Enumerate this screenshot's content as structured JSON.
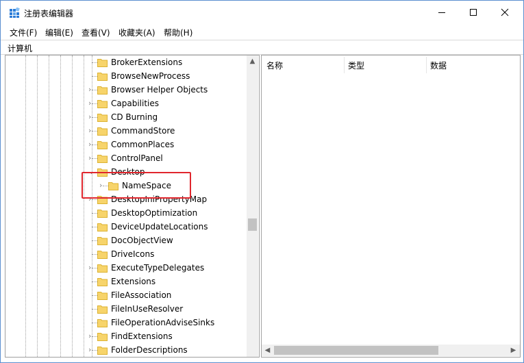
{
  "window": {
    "title": "注册表编辑器"
  },
  "menu": [
    "文件(F)",
    "编辑(E)",
    "查看(V)",
    "收藏夹(A)",
    "帮助(H)"
  ],
  "address": "计算机",
  "tree": [
    {
      "label": "BrokerExtensions",
      "expander": false
    },
    {
      "label": "BrowseNewProcess",
      "expander": false
    },
    {
      "label": "Browser Helper Objects",
      "expander": true
    },
    {
      "label": "Capabilities",
      "expander": true
    },
    {
      "label": "CD Burning",
      "expander": true
    },
    {
      "label": "CommandStore",
      "expander": true
    },
    {
      "label": "CommonPlaces",
      "expander": true
    },
    {
      "label": "ControlPanel",
      "expander": true
    },
    {
      "label": "Desktop",
      "expander": true,
      "expanded": true
    },
    {
      "label": "NameSpace",
      "expander": true,
      "child": true
    },
    {
      "label": "DesktopIniPropertyMap",
      "expander": true
    },
    {
      "label": "DesktopOptimization",
      "expander": false
    },
    {
      "label": "DeviceUpdateLocations",
      "expander": false
    },
    {
      "label": "DocObjectView",
      "expander": false
    },
    {
      "label": "DriveIcons",
      "expander": false
    },
    {
      "label": "ExecuteTypeDelegates",
      "expander": true
    },
    {
      "label": "Extensions",
      "expander": false
    },
    {
      "label": "FileAssociation",
      "expander": false
    },
    {
      "label": "FileInUseResolver",
      "expander": false
    },
    {
      "label": "FileOperationAdviseSinks",
      "expander": false
    },
    {
      "label": "FindExtensions",
      "expander": true
    },
    {
      "label": "FolderDescriptions",
      "expander": true
    }
  ],
  "columns": [
    "名称",
    "类型",
    "数据"
  ],
  "colors": {
    "highlight": "#e0262d",
    "folder": "#f7d46b",
    "folder_edge": "#dcb232"
  },
  "icons": {
    "app": "regedit-icon",
    "minimize": "minimize-icon",
    "maximize": "maximize-icon",
    "close": "close-icon"
  }
}
